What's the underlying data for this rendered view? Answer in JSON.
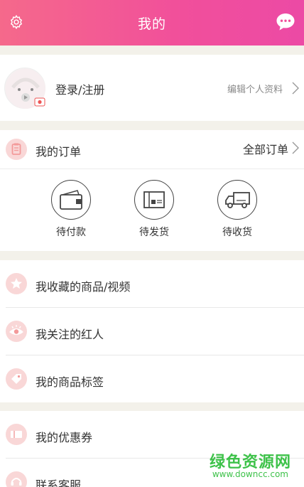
{
  "header": {
    "title": "我的",
    "settings_icon": "gear-icon",
    "message_icon": "chat-bubble-icon",
    "color": "#f14f9b"
  },
  "profile": {
    "login_text": "登录/注册",
    "edit_text": "编辑个人资料",
    "avatar_icon": "avatar-placeholder-icon"
  },
  "orders": {
    "title": "我的订单",
    "all_label": "全部订单",
    "items": [
      {
        "label": "待付款",
        "icon": "wallet-icon"
      },
      {
        "label": "待发货",
        "icon": "package-icon"
      },
      {
        "label": "待收货",
        "icon": "truck-icon"
      }
    ]
  },
  "menu": {
    "items": [
      {
        "label": "我收藏的商品/视频",
        "icon": "star-icon"
      },
      {
        "label": "我关注的红人",
        "icon": "eye-icon"
      },
      {
        "label": "我的商品标签",
        "icon": "tag-icon"
      }
    ]
  },
  "menu2": {
    "items": [
      {
        "label": "我的优惠券",
        "icon": "coupon-icon"
      },
      {
        "label": "联系客服",
        "icon": "service-icon"
      }
    ]
  },
  "watermark": {
    "name": "绿色资源网",
    "url": "www.downcc.com"
  },
  "colors": {
    "accent": "#f14f9b",
    "icon_bg": "#f9d7d7",
    "icon_fg": "#f39a9a",
    "watermark": "#3ec24a"
  }
}
